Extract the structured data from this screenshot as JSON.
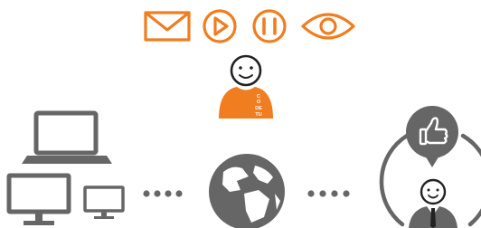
{
  "colors": {
    "accent": "#f07d1f",
    "device": "#666666",
    "background": "#ffffff",
    "badge_text": "#ffffff"
  },
  "icons": {
    "top_row": [
      "envelope-icon",
      "play-icon",
      "pause-icon",
      "eye-icon"
    ],
    "presenter": "presenter-avatar-icon",
    "devices": [
      "laptop-icon",
      "desktop-monitor-icon",
      "small-monitor-icon"
    ],
    "network": "globe-icon",
    "viewer": [
      "thumbs-up-bubble-icon",
      "business-person-icon"
    ]
  },
  "presenter_badge": {
    "lines": [
      "C",
      "O",
      "DE",
      "TU"
    ]
  }
}
